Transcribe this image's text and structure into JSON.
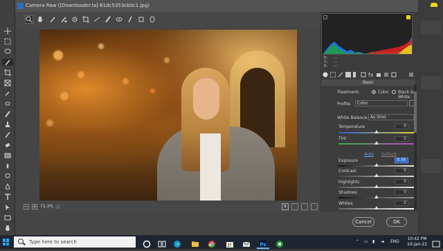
{
  "window": {
    "title": "Camera Raw ([Downloader.la]-61dc5353cb0c1.jpg)"
  },
  "photoshop_tools": [
    "move-icon",
    "marquee-icon",
    "lasso-icon",
    "quick-select-icon",
    "crop-icon",
    "frame-icon",
    "eyedropper-icon",
    "healing-icon",
    "brush-icon",
    "stamp-icon",
    "history-brush-icon",
    "eraser-icon",
    "gradient-icon",
    "blur-icon",
    "dodge-icon",
    "pen-icon",
    "type-icon",
    "path-select-icon",
    "shape-icon",
    "hand-icon",
    "zoom-icon"
  ],
  "camera_raw_tools": [
    "zoom-tool-icon",
    "hand-tool-icon",
    "white-balance-icon",
    "color-sampler-icon",
    "targeted-adjust-icon",
    "crop-tool-icon",
    "straighten-icon",
    "spot-removal-icon",
    "red-eye-icon",
    "adjustment-brush-icon"
  ],
  "preview": {
    "zoom": "72,3%",
    "compare_label": "Y"
  },
  "histogram": {
    "r_label": "R:",
    "g_label": "G:",
    "b_label": "B:",
    "r_value": "---",
    "g_value": "---",
    "b_value": "---"
  },
  "panel": {
    "section_title": "Basic",
    "treatment_label": "Treatment:",
    "treatment_options": [
      "Color",
      "Black & White"
    ],
    "treatment_selected": "Color",
    "profile_label": "Profile:",
    "profile_value": "Color",
    "white_balance_label": "White Balance:",
    "white_balance_value": "As Shot",
    "auto_label": "Auto",
    "default_label": "Default",
    "sliders": [
      {
        "label": "Temperature",
        "value": "0"
      },
      {
        "label": "Tint",
        "value": "0"
      },
      {
        "label": "Exposure",
        "value": "-0.05"
      },
      {
        "label": "Contrast",
        "value": "0"
      },
      {
        "label": "Highlights",
        "value": "0"
      },
      {
        "label": "Shadows",
        "value": "0"
      },
      {
        "label": "Whites",
        "value": "0"
      }
    ]
  },
  "buttons": {
    "cancel": "Cancel",
    "ok": "OK"
  },
  "taskbar": {
    "search_placeholder": "Type here to search",
    "language": "ENG",
    "time": "10:42 PM",
    "date": "10-Jan-22"
  },
  "colors": {
    "accent": "#2a62c8",
    "panel_bg": "#3c3c3c",
    "taskbar_bg": "#1f2530"
  }
}
